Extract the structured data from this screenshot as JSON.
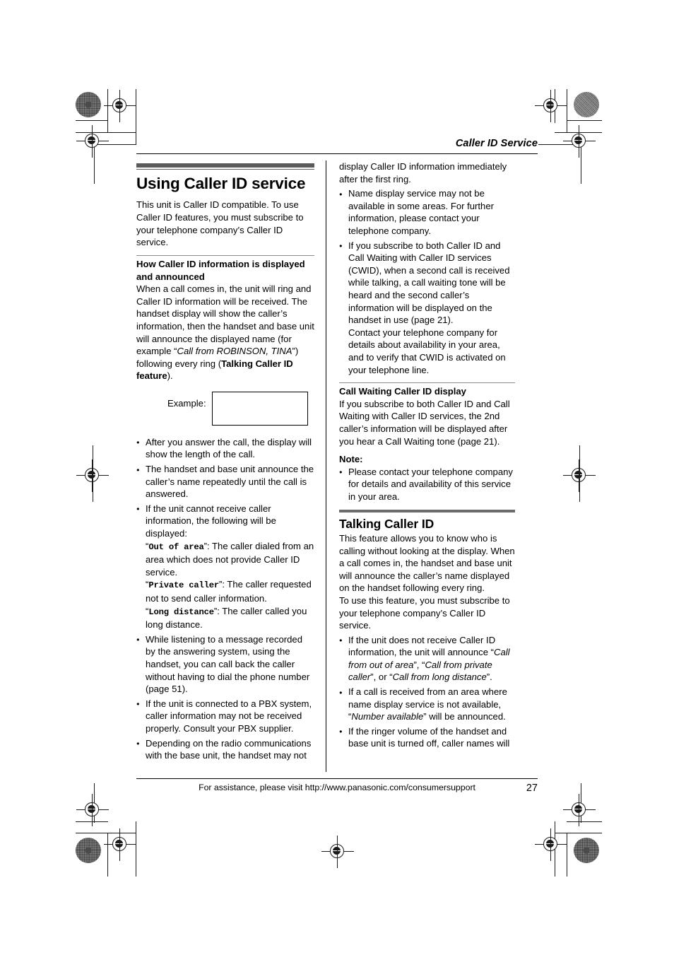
{
  "header": {
    "running_head": "Caller ID Service"
  },
  "left_column": {
    "section_title": "Using Caller ID service",
    "intro": "This unit is Caller ID compatible. To use Caller ID features, you must subscribe to your telephone company’s Caller ID service.",
    "subsection_title": "How Caller ID information is displayed and announced",
    "subsection_body_1": "When a call comes in, the unit will ring and Caller ID information will be received. The handset display will show the caller’s information, then the handset and base unit will announce the displayed name (for example “",
    "subsection_body_italic": "Call from ROBINSON, TINA",
    "subsection_body_2": "”) following every ring (",
    "subsection_body_bold": "Talking Caller ID feature",
    "subsection_body_3": ").",
    "example_label": "Example:",
    "example_display_value": "",
    "bullets": [
      {
        "text": "After you answer the call, the display will show the length of the call."
      },
      {
        "text": "The handset and base unit announce the caller’s name repeatedly until the call is answered."
      },
      {
        "text": "If the unit cannot receive caller information, the following will be displayed:",
        "sub_items": [
          {
            "quote_open": "“",
            "mono": "Out of area",
            "quote_close": "”",
            "rest": ": The caller dialed from an area which does not provide Caller ID service."
          },
          {
            "quote_open": "“",
            "mono": "Private caller",
            "quote_close": "”",
            "rest": ": The caller requested not to send caller information."
          },
          {
            "quote_open": "“",
            "mono": "Long distance",
            "quote_close": "”",
            "rest": ": The caller called you long distance."
          }
        ]
      },
      {
        "text": "While listening to a message recorded by the answering system, using the handset, you can call back the caller without having to dial the phone number (page 51)."
      },
      {
        "text": "If the unit is connected to a PBX system, caller information may not be received properly. Consult your PBX supplier."
      },
      {
        "text": "Depending on the radio communications with the base unit, the handset may not"
      }
    ]
  },
  "right_column": {
    "continuation_text": "display Caller ID information immediately after the first ring.",
    "bullets_top": [
      {
        "text": "Name display service may not be available in some areas. For further information, please contact your telephone company."
      },
      {
        "text": "If you subscribe to both Caller ID and Call Waiting with Caller ID services (CWID), when a second call is received while talking, a call waiting tone will be heard and the second caller’s information will be displayed on the handset in use (page 21).",
        "sub_paragraph": "Contact your telephone company for details about availability in your area, and to verify that CWID is activated on your telephone line."
      }
    ],
    "cwid_heading": "Call Waiting Caller ID display",
    "cwid_body": "If you subscribe to both Caller ID and Call Waiting with Caller ID services, the 2nd caller’s information will be displayed after you hear a Call Waiting tone (page 21).",
    "note_label": "Note:",
    "note_bullets": [
      {
        "text": "Please contact your telephone company for details and availability of this service in your area."
      }
    ],
    "talking_title": "Talking Caller ID",
    "talking_body_1": "This feature allows you to know who is calling without looking at the display. When a call comes in, the handset and base unit will announce the caller’s name displayed on the handset following every ring.",
    "talking_body_2": "To use this feature, you must subscribe to your telephone company’s Caller ID service.",
    "talking_bullets": [
      {
        "pre": "If the unit does not receive Caller ID information, the unit will announce “",
        "it1": "Call from out of area",
        "mid1": "”, “",
        "it2": "Call from private caller",
        "mid2": "”, or “",
        "it3": "Call from long distance",
        "post": "”."
      },
      {
        "pre": "If a call is received from an area where name display service is not available, “",
        "it1": "Number available",
        "post": "” will be announced."
      },
      {
        "pre": "If the ringer volume of the handset and base unit is turned off, caller names will",
        "post": ""
      }
    ]
  },
  "footer": {
    "assistance_text": "For assistance, please visit http://www.panasonic.com/consumersupport",
    "page_number": "27"
  }
}
